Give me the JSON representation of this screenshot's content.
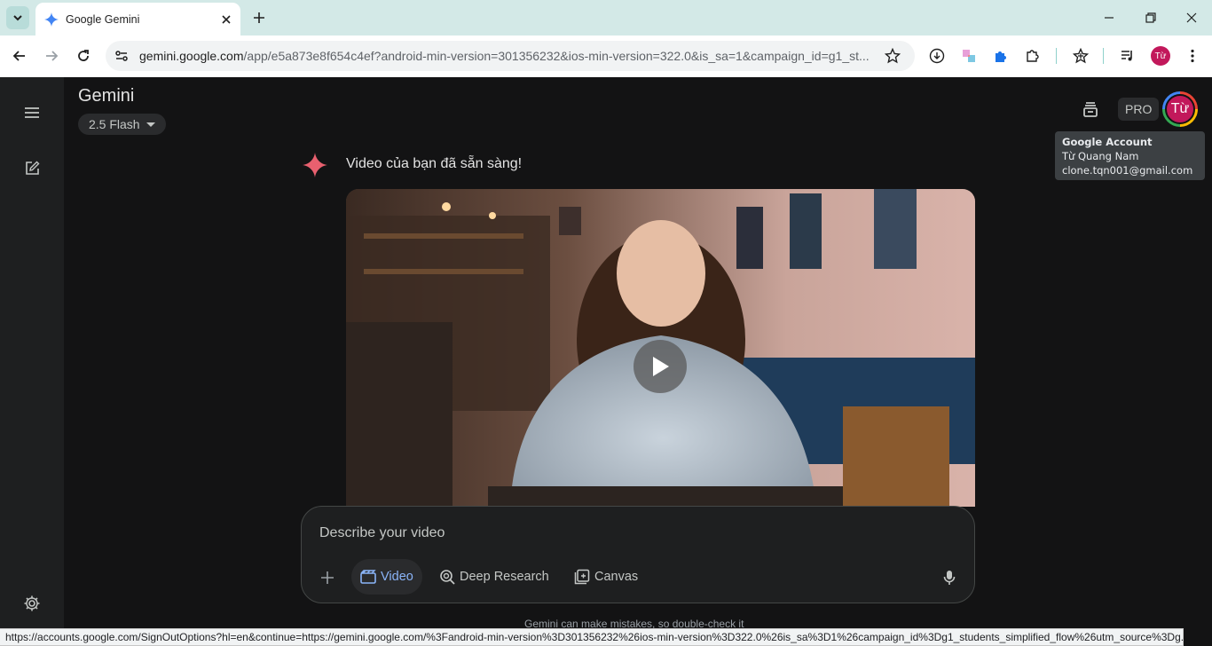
{
  "browser": {
    "tab_title": "Google Gemini",
    "url_host": "gemini.google.com",
    "url_path": "/app/e5a873e8f654c4ef?android-min-version=301356232&ios-min-version=322.0&is_sa=1&campaign_id=g1_st...",
    "profile_initials": "Từ",
    "status_url": "https://accounts.google.com/SignOutOptions?hl=en&continue=https://gemini.google.com/%3Fandroid-min-version%3D301356232%26ios-min-version%3D322.0%26is_sa%3D1%26campaign_id%3Dg1_students_simplified_flow%26utm_source%3Dg..."
  },
  "app": {
    "title": "Gemini",
    "model": "2.5 Flash",
    "pro_label": "PRO",
    "avatar_initials": "Từ"
  },
  "tooltip": {
    "title": "Google Account",
    "name": "Từ Quang Nam",
    "email": "clone.tqn001@gmail.com"
  },
  "chat": {
    "message": "Video của bạn đã sẵn sàng!"
  },
  "composer": {
    "placeholder": "Describe your video",
    "chips": [
      {
        "label": "Video",
        "active": true
      },
      {
        "label": "Deep Research",
        "active": false
      },
      {
        "label": "Canvas",
        "active": false
      }
    ],
    "disclaimer": "Gemini can make mistakes, so double-check it"
  },
  "colors": {
    "accent": "#8ab4f8",
    "spark": "#e8606f",
    "avatar": "#c2185b"
  }
}
